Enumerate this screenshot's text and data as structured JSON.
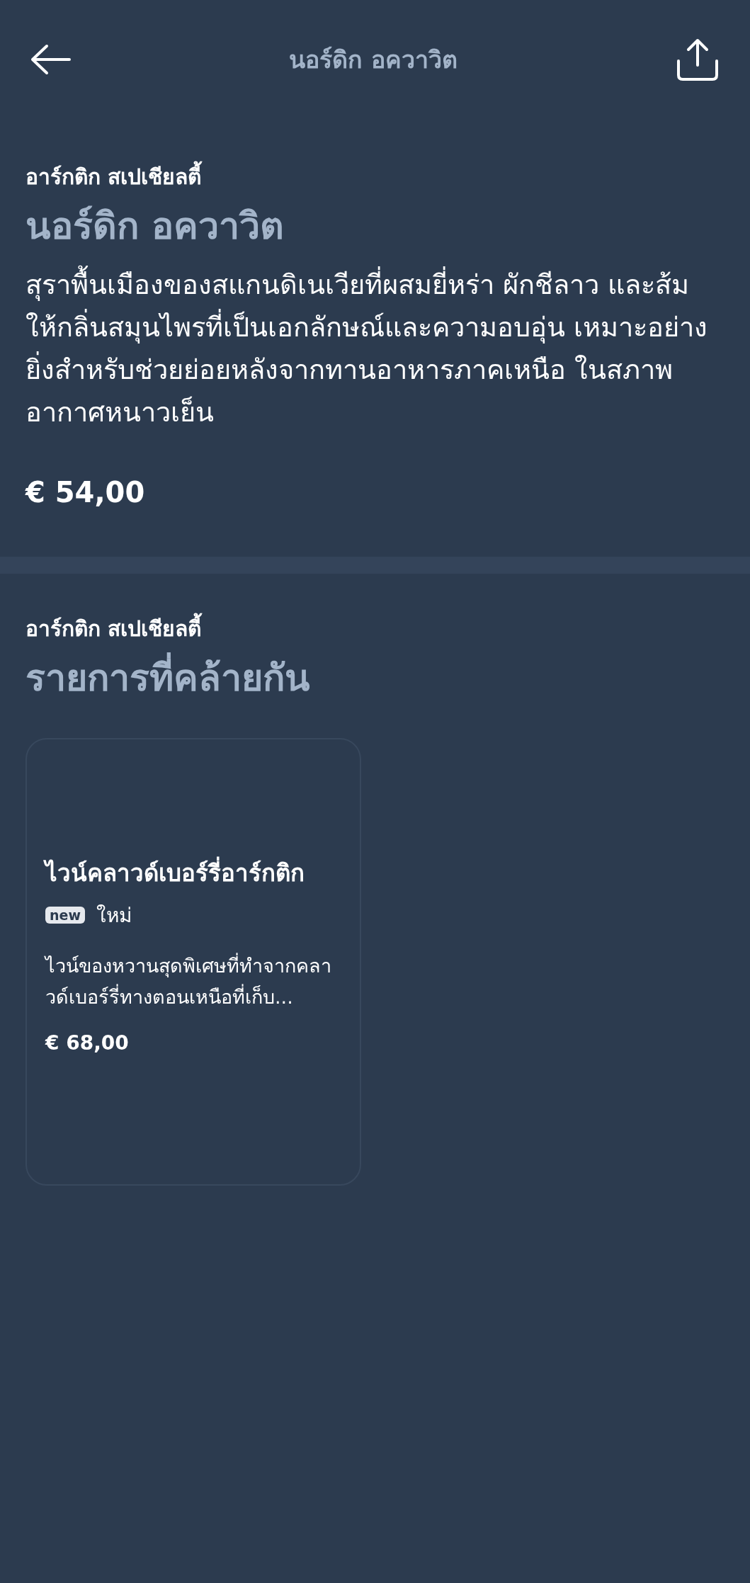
{
  "header": {
    "title": "นอร์ดิก อควาวิต"
  },
  "product": {
    "category": "อาร์กติก สเปเชียลตี้",
    "name": "นอร์ดิก อควาวิต",
    "description": "สุราพื้นเมืองของสแกนดิเนเวียที่ผสมยี่หร่า ผักชีลาว และส้ม ให้กลิ่นสมุนไพรที่เป็นเอกลักษณ์และความอบอุ่น เหมาะอย่างยิ่งสำหรับช่วยย่อยหลังจากทานอาหารภาคเหนือ ในสภาพอากาศหนาวเย็น",
    "price": "€ 54,00"
  },
  "similar": {
    "category": "อาร์กติก สเปเชียลตี้",
    "heading": "รายการที่คล้ายกัน",
    "items": [
      {
        "name": "ไวน์คลาวด์เบอร์รี่อาร์กติก",
        "badge": "new",
        "badge_label": "ใหม่",
        "description": "ไวน์ของหวานสุดพิเศษที่ทำจากคลาวด์เบอร์รี่ทางตอนเหนือที่เก็บ...",
        "price": "€ 68,00"
      }
    ]
  }
}
